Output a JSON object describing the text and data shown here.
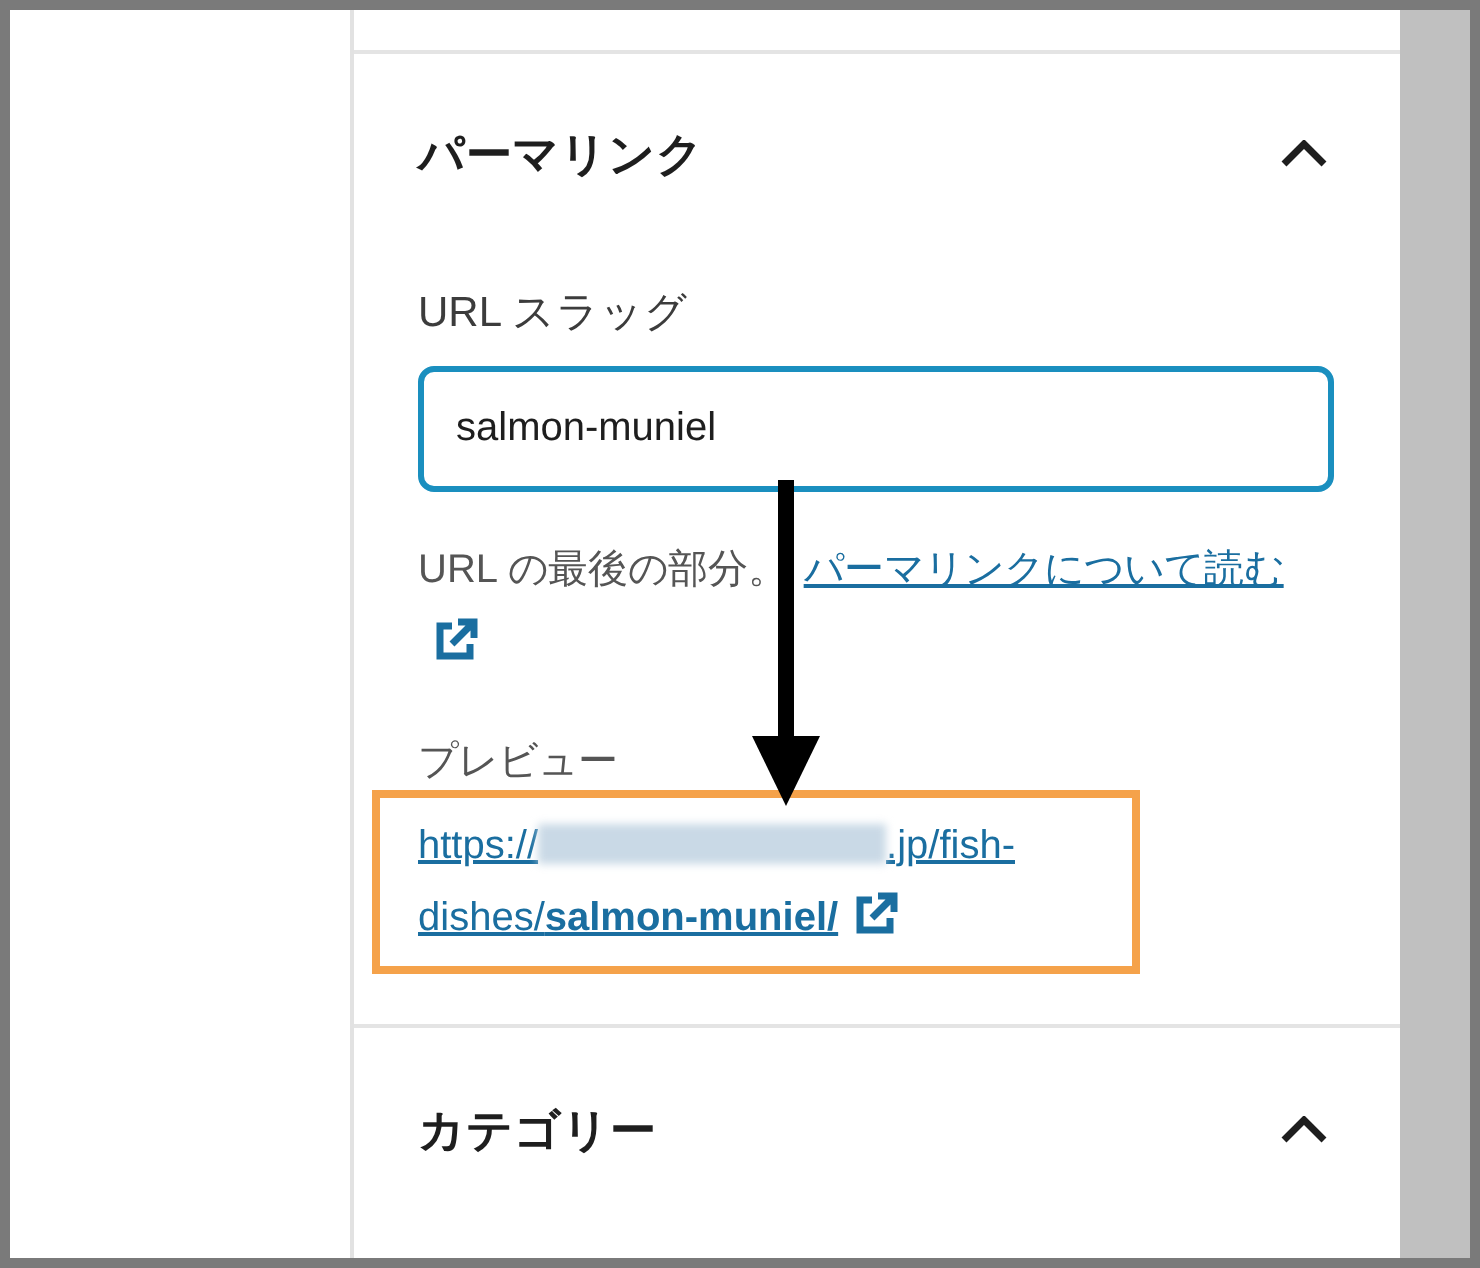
{
  "sections": [
    {
      "title": "パーマリンク",
      "expanded": true,
      "slug_label": "URL スラッグ",
      "slug_value": "salmon-muniel",
      "help_text": "URL の最後の部分。",
      "help_link": "パーマリンクについて読む",
      "preview_label": "プレビュー",
      "preview_url_prefix": "https://",
      "preview_url_suffix": ".jp/fish-dishes/**salmon-muniel/**"
    },
    {
      "title": "カテゴリー",
      "expanded": true
    }
  ]
}
